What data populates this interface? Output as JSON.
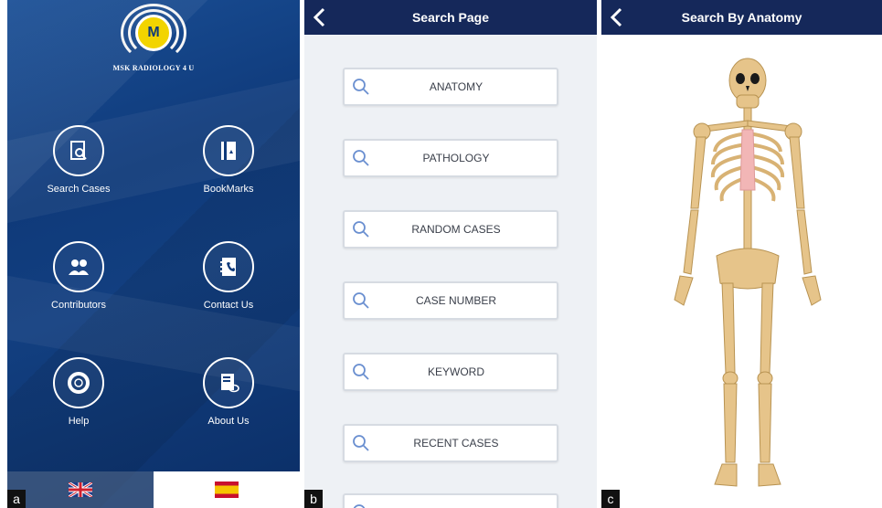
{
  "panel_a": {
    "letter": "a",
    "logo_letter": "M",
    "app_title": "MSK RADIOLOGY 4 U",
    "menu": [
      {
        "label": "Search Cases",
        "icon": "search-document-icon"
      },
      {
        "label": "BookMarks",
        "icon": "bookmark-book-icon"
      },
      {
        "label": "Contributors",
        "icon": "people-icon"
      },
      {
        "label": "Contact Us",
        "icon": "address-book-icon"
      },
      {
        "label": "Help",
        "icon": "lifebuoy-icon"
      },
      {
        "label": "About Us",
        "icon": "document-chat-icon"
      }
    ],
    "languages": [
      {
        "name": "English",
        "icon": "uk-flag-icon",
        "selected": false
      },
      {
        "name": "Spanish",
        "icon": "spain-flag-icon",
        "selected": true
      }
    ]
  },
  "panel_b": {
    "letter": "b",
    "title": "Search Page",
    "buttons": [
      "ANATOMY",
      "PATHOLOGY",
      "RANDOM CASES",
      "CASE NUMBER",
      "KEYWORD",
      "RECENT CASES"
    ]
  },
  "panel_c": {
    "letter": "c",
    "title": "Search By Anatomy"
  },
  "colors": {
    "navbar": "#15285a",
    "panel_a_bg": "#0f3a7a",
    "logo_yellow": "#f2d400",
    "bone": "#e6c48a"
  }
}
